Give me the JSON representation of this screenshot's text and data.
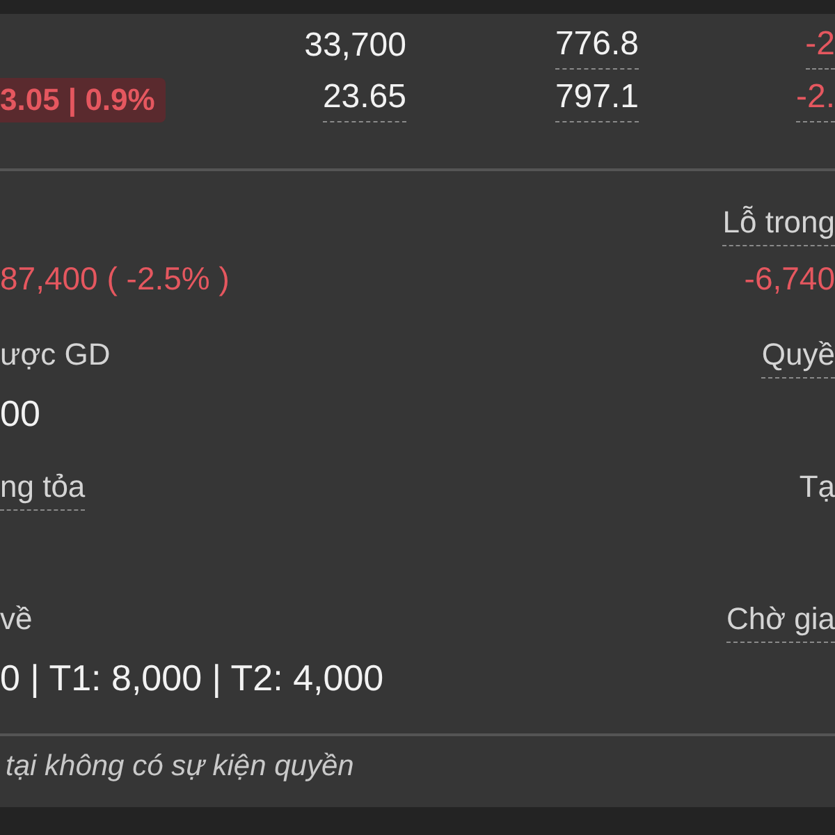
{
  "quote_rows": [
    {
      "cells": [
        {
          "text": "33,700",
          "dashed": false,
          "negative": false
        },
        {
          "text": "776.8",
          "dashed": true,
          "negative": false
        },
        {
          "text": "-2",
          "dashed": true,
          "negative": true
        }
      ]
    },
    {
      "badge": "3.05 | 0.9%",
      "cells": [
        {
          "text": "23.65",
          "dashed": true,
          "negative": false
        },
        {
          "text": "797.1",
          "dashed": true,
          "negative": false
        },
        {
          "text": "-2.",
          "dashed": true,
          "negative": true
        }
      ]
    }
  ],
  "details": [
    {
      "left": {
        "value": "87,400 ( -2.5% )",
        "negative": true,
        "kind": "change"
      },
      "right": {
        "label": "Lỗ trong",
        "label_dashed": true,
        "value": "-6,740",
        "negative": true
      }
    },
    {
      "left": {
        "label": "ược GD",
        "label_dashed": false,
        "value": "00",
        "negative": false,
        "kind": "quantity"
      },
      "right": {
        "label": "Quyề",
        "label_dashed": true
      }
    },
    {
      "left": {
        "label": "ng tỏa",
        "label_dashed": true
      },
      "right": {
        "label": "Tạ",
        "label_dashed": false
      }
    },
    {
      "left": {
        "label": "về",
        "label_dashed": false,
        "value": "0 | T1: 8,000 | T2: 4,000",
        "negative": false,
        "kind": "quantity"
      },
      "right": {
        "label": "Chờ gia",
        "label_dashed": true
      }
    }
  ],
  "footer_note": "tại không có sự kiện quyền"
}
